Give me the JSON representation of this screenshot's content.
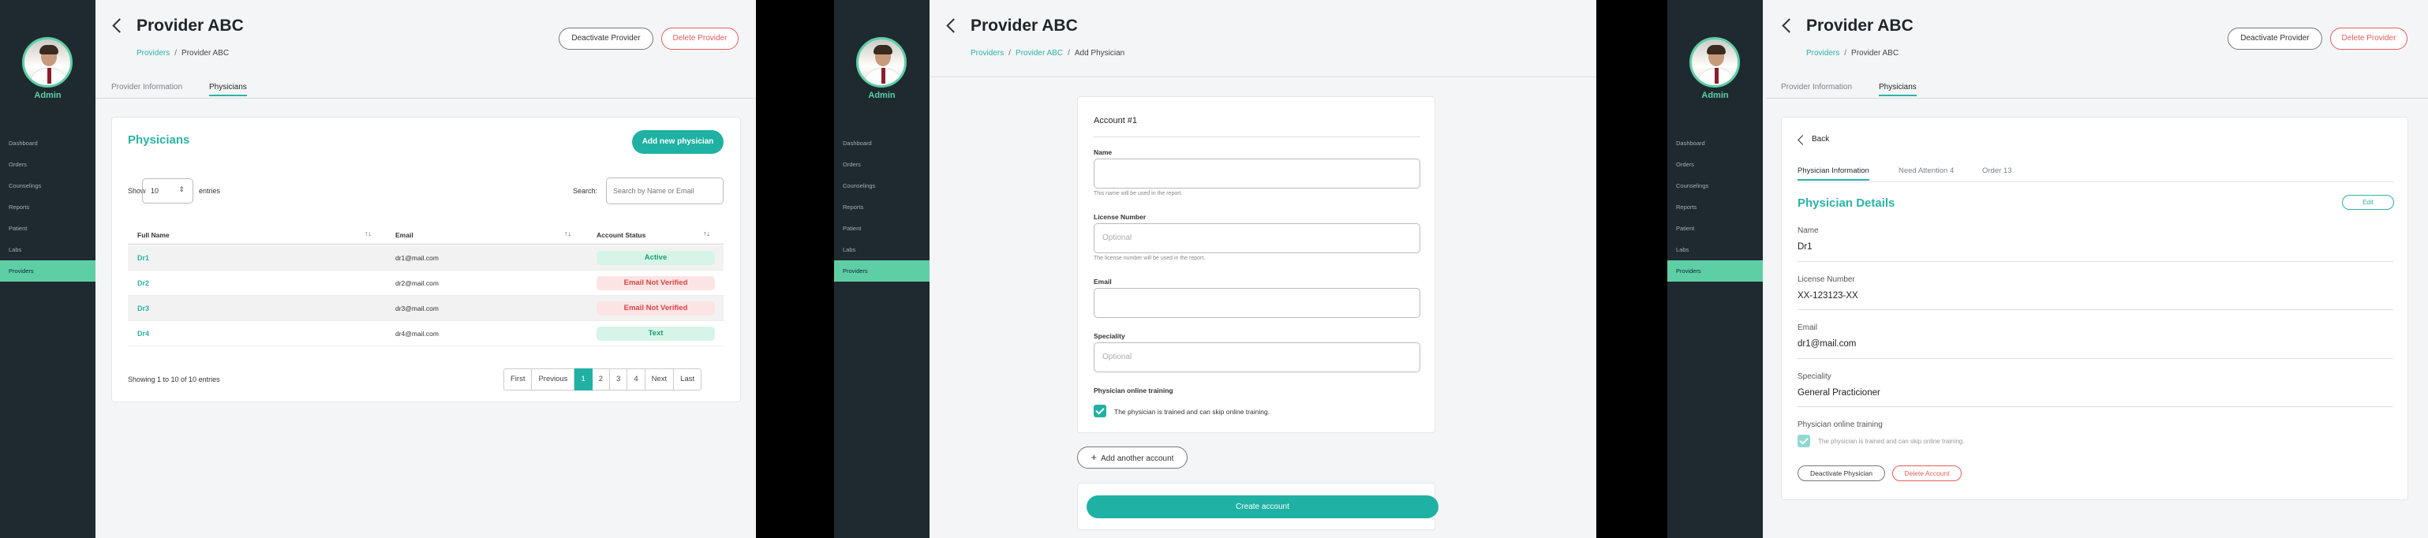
{
  "sidebar": {
    "role": "Admin",
    "items": [
      "Dashboard",
      "Orders",
      "Counselings",
      "Reports",
      "Patient",
      "Labs",
      "Providers"
    ],
    "active": "Providers"
  },
  "provider": {
    "title": "Provider ABC",
    "deactivate_label": "Deactivate Provider",
    "delete_label": "Delete Provider"
  },
  "breadcrumbs": {
    "providers": "Providers",
    "sep": "/",
    "provider": "Provider ABC",
    "add_physician": "Add Physician"
  },
  "tabs": {
    "info": "Provider Information",
    "physicians": "Physicians"
  },
  "list": {
    "heading": "Physicians",
    "add_label": "Add new physician",
    "show_label": "Show",
    "entries_value": "10",
    "entries_label": "entries",
    "search_label": "Search:",
    "search_placeholder": "Search by Name or Email",
    "columns": [
      "Full Name",
      "Email",
      "Account Status"
    ],
    "sort_glyph": "↑↓",
    "rows": [
      {
        "name": "Dr1",
        "email": "dr1@mail.com",
        "status": "Active"
      },
      {
        "name": "Dr2",
        "email": "dr2@mail.com",
        "status": "Email Not Verified"
      },
      {
        "name": "Dr3",
        "email": "dr3@mail.com",
        "status": "Email Not Verified"
      },
      {
        "name": "Dr4",
        "email": "dr4@mail.com",
        "status": "Text"
      }
    ],
    "showing": "Showing 1 to 10 of 10 entries",
    "pager": [
      "First",
      "Previous",
      "1",
      "2",
      "3",
      "4",
      "Next",
      "Last"
    ],
    "current_page": "1"
  },
  "form": {
    "account_title": "Account #1",
    "name_label": "Name",
    "name_hint": "This name will be used in the report.",
    "license_label": "License Number",
    "license_placeholder": "Optional",
    "license_hint": "The license number will be used in the report.",
    "email_label": "Email",
    "speciality_label": "Speciality",
    "speciality_placeholder": "Optional",
    "training_label": "Physician online training",
    "training_text": "The physician is trained and can skip online training.",
    "add_account_label": "Add another account",
    "add_account_icon": "+",
    "create_label": "Create account"
  },
  "detail": {
    "back_label": "Back",
    "tabs": [
      "Physician Information",
      "Need Attention 4",
      "Order 13"
    ],
    "heading": "Physician Details",
    "edit_label": "Edit",
    "name_label": "Name",
    "name_value": "Dr1",
    "license_label": "License Number",
    "license_value": "XX-123123-XX",
    "email_label": "Email",
    "email_value": "dr1@mail.com",
    "speciality_label": "Speciality",
    "speciality_value": "General Practicioner",
    "training_label": "Physician online training",
    "training_text": "The physician is trained and can skip online training.",
    "deactivate_label": "Deactivate Physician",
    "delete_label": "Delete Account"
  },
  "colors": {
    "accent": "#1fb1a3",
    "sidebar": "#1e2a30",
    "active_nav": "#5ecfa5",
    "danger": "#e55d5d"
  }
}
